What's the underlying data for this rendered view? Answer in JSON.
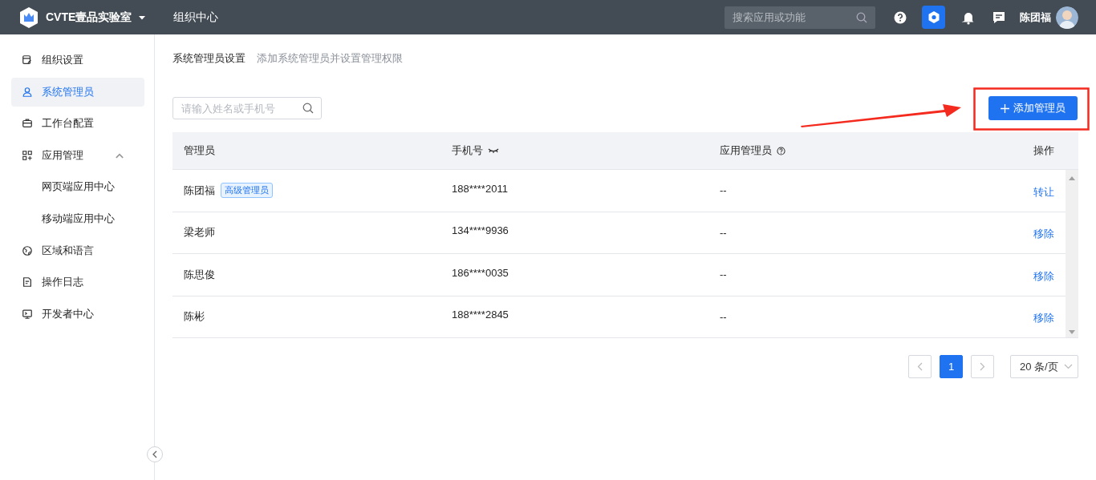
{
  "header": {
    "org_name": "CVTE壹品实验室",
    "nav_title": "组织中心",
    "search": {
      "placeholder": "搜索应用或功能"
    },
    "user_name": "陈团福"
  },
  "sidebar": {
    "items": [
      {
        "label": "组织设置",
        "selected": false
      },
      {
        "label": "系统管理员",
        "selected": true
      },
      {
        "label": "工作台配置",
        "selected": false
      },
      {
        "label": "应用管理",
        "selected": false,
        "expanded": true,
        "children": [
          {
            "label": "网页端应用中心",
            "selected": false
          },
          {
            "label": "移动端应用中心",
            "selected": false
          }
        ]
      },
      {
        "label": "区域和语言",
        "selected": false
      },
      {
        "label": "操作日志",
        "selected": false
      },
      {
        "label": "开发者中心",
        "selected": false
      }
    ]
  },
  "page": {
    "title": "系统管理员设置",
    "subtitle": "添加系统管理员并设置管理权限",
    "search": {
      "placeholder": "请输入姓名或手机号"
    },
    "add_button": "添加管理员"
  },
  "table": {
    "columns": [
      "管理员",
      "手机号",
      "应用管理员",
      "操作"
    ],
    "rows": [
      {
        "name": "陈团福",
        "tag": "高级管理员",
        "phone": "188****2011",
        "app_admin": "--",
        "action": "转让"
      },
      {
        "name": "梁老师",
        "phone": "134****9936",
        "app_admin": "--",
        "action": "移除"
      },
      {
        "name": "陈思俊",
        "phone": "186****0035",
        "app_admin": "--",
        "action": "移除"
      },
      {
        "name": "陈彬",
        "phone": "188****2845",
        "app_admin": "--",
        "action": "移除"
      }
    ]
  },
  "pagination": {
    "pages": [
      {
        "label": "1",
        "selected": true
      }
    ],
    "page_size": "20 条/页"
  }
}
